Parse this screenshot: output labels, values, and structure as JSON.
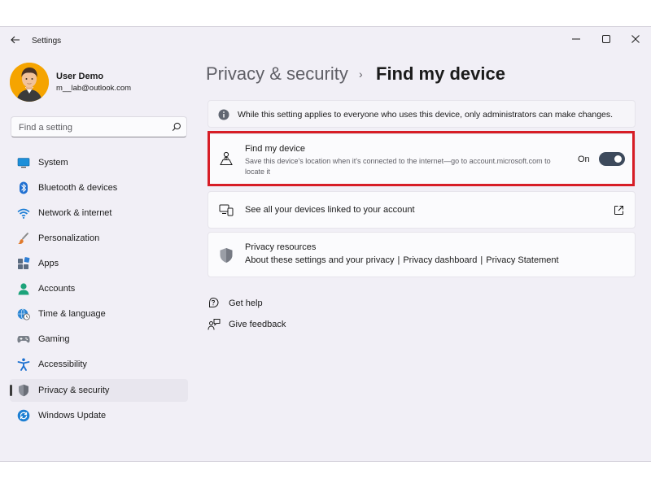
{
  "window": {
    "title": "Settings"
  },
  "user": {
    "name": "User Demo",
    "email": "m__lab@outlook.com"
  },
  "search": {
    "placeholder": "Find a setting"
  },
  "sidebar": {
    "items": [
      {
        "label": "System",
        "icon": "monitor-icon"
      },
      {
        "label": "Bluetooth & devices",
        "icon": "bluetooth-icon"
      },
      {
        "label": "Network & internet",
        "icon": "wifi-icon"
      },
      {
        "label": "Personalization",
        "icon": "brush-icon"
      },
      {
        "label": "Apps",
        "icon": "apps-icon"
      },
      {
        "label": "Accounts",
        "icon": "person-icon"
      },
      {
        "label": "Time & language",
        "icon": "globe-clock-icon"
      },
      {
        "label": "Gaming",
        "icon": "gamepad-icon"
      },
      {
        "label": "Accessibility",
        "icon": "accessibility-icon"
      },
      {
        "label": "Privacy & security",
        "icon": "shield-icon",
        "selected": true
      },
      {
        "label": "Windows Update",
        "icon": "update-icon"
      }
    ]
  },
  "breadcrumb": {
    "parent": "Privacy & security",
    "separator": "›",
    "current": "Find my device"
  },
  "info": {
    "text": "While this setting applies to everyone who uses this device, only administrators can make changes."
  },
  "find_my_device": {
    "title": "Find my device",
    "description": "Save this device's location when it's connected to the internet—go to account.microsoft.com to locate it",
    "state_label": "On",
    "enabled": true
  },
  "devices_link": {
    "label": "See all your devices linked to your account"
  },
  "privacy_resources": {
    "title": "Privacy resources",
    "links": [
      "About these settings and your privacy",
      "Privacy dashboard",
      "Privacy Statement"
    ],
    "separator": "|"
  },
  "help": {
    "get_help": "Get help",
    "give_feedback": "Give feedback"
  },
  "colors": {
    "window_bg": "#f1eff6",
    "card_bg": "#fbfbfd",
    "toggle_on": "#3d4a5c",
    "highlight": "#d71d26",
    "accent": "#0067c0"
  }
}
